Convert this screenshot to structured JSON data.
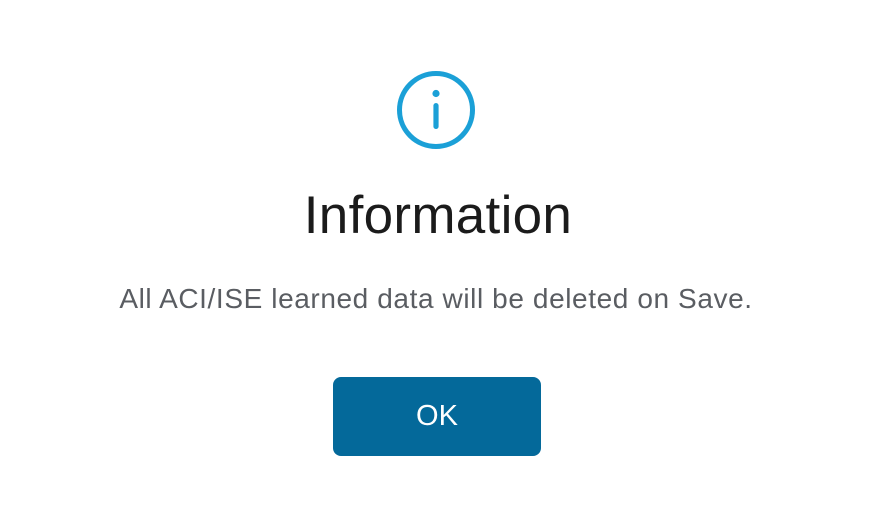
{
  "dialog": {
    "icon": "info-circle-icon",
    "title": "Information",
    "message": "All ACI/ISE learned data will be deleted on Save.",
    "ok_label": "OK"
  },
  "colors": {
    "accent_icon": "#1ba0d7",
    "button_background": "#04699a",
    "button_text": "#ffffff",
    "title_text": "#1b1b1b",
    "message_text": "#5a5d62"
  }
}
